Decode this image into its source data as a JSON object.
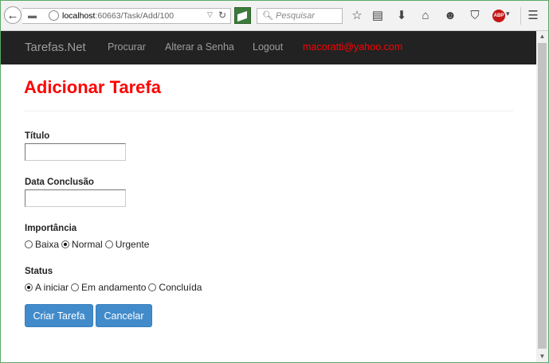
{
  "browser": {
    "url_host": "localhost",
    "url_path": ":60663/Task/Add/100",
    "search_placeholder": "Pesquisar"
  },
  "navbar": {
    "brand": "Tarefas.Net",
    "links": [
      "Procurar",
      "Alterar a Senha",
      "Logout"
    ],
    "user_email": "macoratti@yahoo.com",
    "email_color": "#ff0000"
  },
  "page": {
    "title": "Adicionar Tarefa",
    "title_color": "#ff0000"
  },
  "form": {
    "titulo_label": "Título",
    "titulo_value": "",
    "data_label": "Data Conclusão",
    "data_value": "",
    "importancia_label": "Importância",
    "importancia_options": [
      "Baixa",
      "Normal",
      "Urgente"
    ],
    "importancia_selected": "Normal",
    "status_label": "Status",
    "status_options": [
      "A iniciar",
      "Em andamento",
      "Concluída"
    ],
    "status_selected": "A iniciar"
  },
  "buttons": {
    "create": "Criar Tarefa",
    "cancel": "Cancelar",
    "color": "#428bca"
  }
}
